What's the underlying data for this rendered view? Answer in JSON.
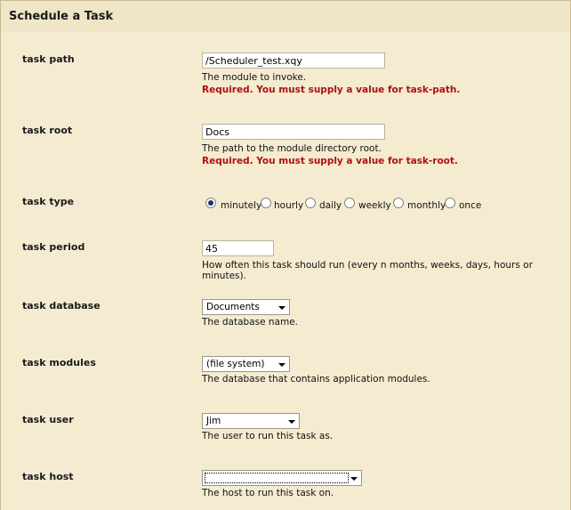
{
  "header": {
    "title": "Schedule a Task"
  },
  "fields": {
    "task_path": {
      "label": "task path",
      "value": "/Scheduler_test.xqy",
      "help": "The module to invoke.",
      "error": "Required. You must supply a value for task-path."
    },
    "task_root": {
      "label": "task root",
      "value": "Docs",
      "help": "The path to the module directory root.",
      "error": "Required. You must supply a value for task-root."
    },
    "task_type": {
      "label": "task type",
      "options": [
        "minutely",
        "hourly",
        "daily",
        "weekly",
        "monthly",
        "once"
      ],
      "selected": "minutely"
    },
    "task_period": {
      "label": "task period",
      "value": "45",
      "help": "How often this task should run (every n months, weeks, days, hours or minutes)."
    },
    "task_database": {
      "label": "task database",
      "value": "Documents",
      "help": "The database name."
    },
    "task_modules": {
      "label": "task modules",
      "value": "(file system)",
      "help": "The database that contains application modules."
    },
    "task_user": {
      "label": "task user",
      "value": "Jim",
      "help": "The user to run this task as."
    },
    "task_host": {
      "label": "task host",
      "value": "",
      "help": "The host to run this task on."
    }
  }
}
